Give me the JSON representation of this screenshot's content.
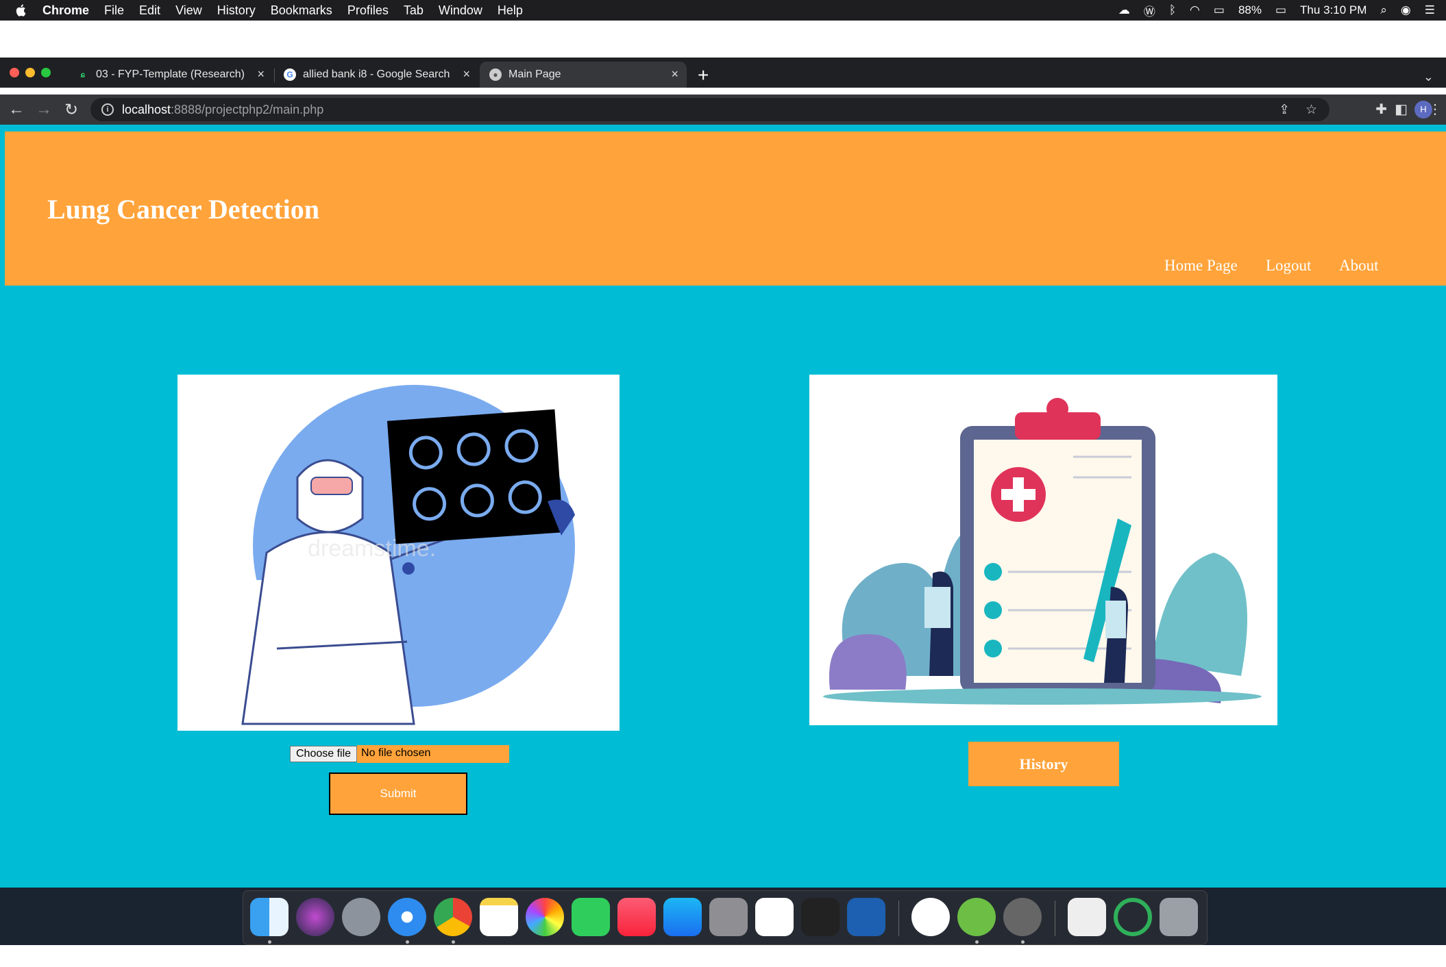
{
  "menubar": {
    "app_name": "Chrome",
    "items": [
      "File",
      "Edit",
      "View",
      "History",
      "Bookmarks",
      "Profiles",
      "Tab",
      "Window",
      "Help"
    ],
    "battery": "88%",
    "clock": "Thu 3:10 PM"
  },
  "tabs": [
    {
      "title": "03 - FYP-Template (Research)",
      "favicon": "grammarly-icon"
    },
    {
      "title": "allied bank i8 - Google Search",
      "favicon": "google-icon"
    },
    {
      "title": "Main Page",
      "favicon": "php-elephant-icon",
      "active": true
    }
  ],
  "toolbar": {
    "url_host": "localhost",
    "url_rest": ":8888/projectphp2/main.php",
    "profile_initial": "H"
  },
  "page": {
    "site_title": "Lung Cancer Detection",
    "nav": [
      "Home Page",
      "Logout",
      "About"
    ],
    "file_button": "Choose file",
    "file_status": "No file chosen",
    "submit_label": "Submit",
    "history_label": "History",
    "watermark": "dreamstime."
  },
  "colors": {
    "header": "#ffa33a",
    "background": "#00bcd4",
    "button": "#ffa33a"
  },
  "dock": {
    "apps": [
      "finder-icon",
      "siri-icon",
      "launchpad-icon",
      "safari-icon",
      "chrome-icon",
      "notes-icon",
      "photos-icon",
      "facetime-icon",
      "music-icon",
      "app-store-icon",
      "system-preferences-icon",
      "vscode-icon",
      "prism-icon",
      "tableplus-icon",
      "xampp-icon",
      "utorrent-icon",
      "mamp-icon",
      "archive-icon",
      "torrent-icon",
      "trash-icon"
    ]
  }
}
